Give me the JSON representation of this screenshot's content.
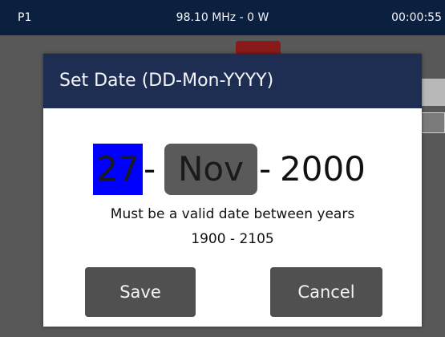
{
  "status_bar": {
    "preset": "P1",
    "frequency_power": "98.10 MHz - 0 W",
    "time": "00:00:55"
  },
  "dialog": {
    "title": "Set Date (DD-Mon-YYYY)",
    "date": {
      "day": "27",
      "separator": "-",
      "month": "Nov",
      "year": "2000"
    },
    "hint_line1": "Must be a valid date between years",
    "hint_line2": "1900 - 2105",
    "save_label": "Save",
    "cancel_label": "Cancel"
  },
  "colors": {
    "header": "#1e2d52",
    "status_bar": "#0b1f3e",
    "day_highlight": "#0000ff",
    "month_highlight": "#5a5a5a",
    "button": "#505050"
  }
}
